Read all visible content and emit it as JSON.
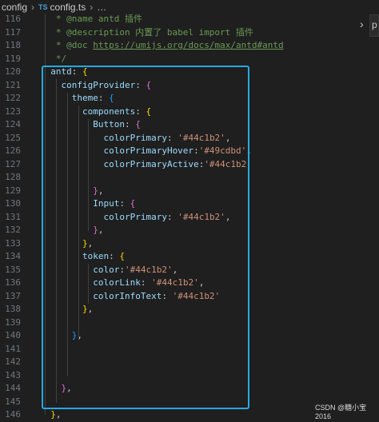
{
  "breadcrumb": {
    "folder": "config",
    "sep": "›",
    "file_type": "TS",
    "file": "config.ts",
    "more": "…"
  },
  "right_tab": {
    "label": "p",
    "chevron": "›"
  },
  "colors": {
    "keyword_blue": "#9cdcfe",
    "string": "#ce9178",
    "comment": "#6a9955",
    "highlight_border": "#29a8e0"
  },
  "lines": [
    {
      "n": "116",
      "parts": [
        {
          "t": "   * ",
          "c": "c-green"
        },
        {
          "t": "@name antd 插件",
          "c": "c-green"
        }
      ]
    },
    {
      "n": "117",
      "parts": [
        {
          "t": "   * @description 内置了 babel import 插件",
          "c": "c-green"
        }
      ]
    },
    {
      "n": "118",
      "parts": [
        {
          "t": "   * @doc ",
          "c": "c-green"
        },
        {
          "t": "https://umijs.org/docs/max/antd#antd",
          "c": "c-link"
        }
      ]
    },
    {
      "n": "119",
      "parts": [
        {
          "t": "   */",
          "c": "c-green"
        }
      ]
    },
    {
      "n": "120",
      "parts": [
        {
          "t": "  antd",
          "c": "c-key"
        },
        {
          "t": ": ",
          "c": "c-punct"
        },
        {
          "t": "{",
          "c": "b1"
        }
      ]
    },
    {
      "n": "121",
      "parts": [
        {
          "t": "    configProvider",
          "c": "c-key"
        },
        {
          "t": ": ",
          "c": "c-punct"
        },
        {
          "t": "{",
          "c": "b2"
        }
      ]
    },
    {
      "n": "122",
      "parts": [
        {
          "t": "      theme",
          "c": "c-key"
        },
        {
          "t": ": ",
          "c": "c-punct"
        },
        {
          "t": "{",
          "c": "b3"
        }
      ]
    },
    {
      "n": "123",
      "parts": [
        {
          "t": "        components",
          "c": "c-key"
        },
        {
          "t": ": ",
          "c": "c-punct"
        },
        {
          "t": "{",
          "c": "b1"
        }
      ]
    },
    {
      "n": "124",
      "parts": [
        {
          "t": "          Button",
          "c": "c-key"
        },
        {
          "t": ": ",
          "c": "c-punct"
        },
        {
          "t": "{",
          "c": "b2"
        }
      ]
    },
    {
      "n": "125",
      "parts": [
        {
          "t": "            colorPrimary",
          "c": "c-key"
        },
        {
          "t": ": ",
          "c": "c-punct"
        },
        {
          "t": "'#44c1b2'",
          "c": "c-str"
        },
        {
          "t": ",",
          "c": "c-punct"
        }
      ]
    },
    {
      "n": "126",
      "parts": [
        {
          "t": "            colorPrimaryHover",
          "c": "c-key"
        },
        {
          "t": ":",
          "c": "c-punct"
        },
        {
          "t": "'#49cdbd'",
          "c": "c-str"
        },
        {
          "t": ",",
          "c": "c-punct"
        }
      ]
    },
    {
      "n": "127",
      "parts": [
        {
          "t": "            colorPrimaryActive",
          "c": "c-key"
        },
        {
          "t": ":",
          "c": "c-punct"
        },
        {
          "t": "'#44c1b2'",
          "c": "c-str"
        }
      ]
    },
    {
      "n": "128",
      "parts": []
    },
    {
      "n": "129",
      "parts": [
        {
          "t": "          }",
          "c": "b2"
        },
        {
          "t": ",",
          "c": "c-punct"
        }
      ]
    },
    {
      "n": "130",
      "parts": [
        {
          "t": "          Input",
          "c": "c-key"
        },
        {
          "t": ": ",
          "c": "c-punct"
        },
        {
          "t": "{",
          "c": "b2"
        }
      ]
    },
    {
      "n": "131",
      "parts": [
        {
          "t": "            colorPrimary",
          "c": "c-key"
        },
        {
          "t": ": ",
          "c": "c-punct"
        },
        {
          "t": "'#44c1b2'",
          "c": "c-str"
        },
        {
          "t": ",",
          "c": "c-punct"
        }
      ]
    },
    {
      "n": "132",
      "parts": [
        {
          "t": "          }",
          "c": "b2"
        },
        {
          "t": ",",
          "c": "c-punct"
        }
      ]
    },
    {
      "n": "133",
      "parts": [
        {
          "t": "        }",
          "c": "b1"
        },
        {
          "t": ",",
          "c": "c-punct"
        }
      ]
    },
    {
      "n": "134",
      "parts": [
        {
          "t": "        token",
          "c": "c-key"
        },
        {
          "t": ": ",
          "c": "c-punct"
        },
        {
          "t": "{",
          "c": "b1"
        }
      ]
    },
    {
      "n": "135",
      "parts": [
        {
          "t": "          color",
          "c": "c-key"
        },
        {
          "t": ":",
          "c": "c-punct"
        },
        {
          "t": "'#44c1b2'",
          "c": "c-str"
        },
        {
          "t": ",",
          "c": "c-punct"
        }
      ]
    },
    {
      "n": "136",
      "parts": [
        {
          "t": "          colorLink",
          "c": "c-key"
        },
        {
          "t": ": ",
          "c": "c-punct"
        },
        {
          "t": "'#44c1b2'",
          "c": "c-str"
        },
        {
          "t": ",",
          "c": "c-punct"
        }
      ]
    },
    {
      "n": "137",
      "parts": [
        {
          "t": "          colorInfoText",
          "c": "c-key"
        },
        {
          "t": ": ",
          "c": "c-punct"
        },
        {
          "t": "'#44c1b2'",
          "c": "c-str"
        }
      ]
    },
    {
      "n": "138",
      "parts": [
        {
          "t": "        }",
          "c": "b1"
        },
        {
          "t": ",",
          "c": "c-punct"
        }
      ]
    },
    {
      "n": "139",
      "parts": []
    },
    {
      "n": "140",
      "parts": [
        {
          "t": "      }",
          "c": "b3"
        },
        {
          "t": ",",
          "c": "c-punct"
        }
      ]
    },
    {
      "n": "141",
      "parts": []
    },
    {
      "n": "142",
      "parts": []
    },
    {
      "n": "143",
      "parts": []
    },
    {
      "n": "144",
      "parts": [
        {
          "t": "    }",
          "c": "b2"
        },
        {
          "t": ",",
          "c": "c-punct"
        }
      ]
    },
    {
      "n": "145",
      "parts": []
    },
    {
      "n": "146",
      "parts": [
        {
          "t": "  }",
          "c": "b1"
        },
        {
          "t": ",",
          "c": "c-punct"
        }
      ]
    }
  ],
  "watermark": "CSDN @糖小宝2016"
}
